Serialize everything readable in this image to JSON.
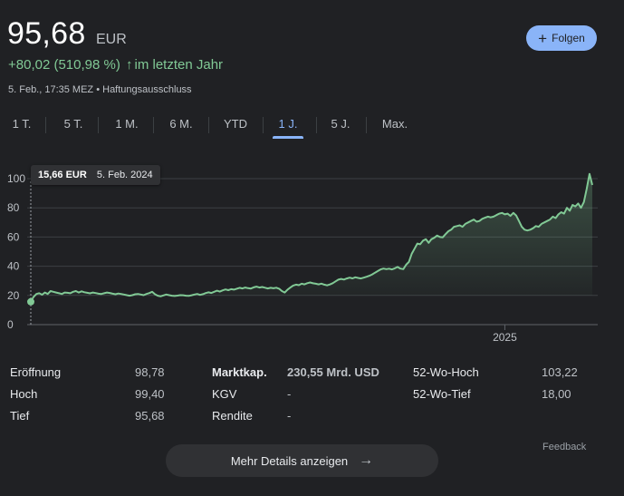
{
  "quote": {
    "price": "95,68",
    "currency": "EUR",
    "change_text": "+80,02 (510,98 %)",
    "change_arrow": "↑",
    "change_period": "im letzten Jahr",
    "meta": "5. Feb., 17:35 MEZ • Haftungsausschluss"
  },
  "follow_button": {
    "label": "Folgen",
    "icon": "plus-icon"
  },
  "tabs": [
    "1 T.",
    "5 T.",
    "1 M.",
    "6 M.",
    "YTD",
    "1 J.",
    "5 J.",
    "Max."
  ],
  "active_tab": "1 J.",
  "tooltip": {
    "price": "15,66 EUR",
    "date": "5. Feb. 2024"
  },
  "colors": {
    "accent": "#8ab4f8",
    "positive": "#81c995",
    "background": "#202124"
  },
  "chart_data": {
    "type": "area",
    "y_ticks": [
      0,
      20,
      40,
      60,
      80,
      100
    ],
    "ylim": [
      0,
      105
    ],
    "x_tick_labels": [
      {
        "label": "2025",
        "index": 168
      }
    ],
    "grid": true,
    "series": [
      {
        "values": [
          15.66,
          19,
          21,
          21.5,
          20.5,
          22,
          21,
          23,
          22.5,
          22,
          21.5,
          21,
          22,
          21.8,
          21.5,
          22.5,
          23,
          22,
          22.8,
          22.2,
          21.8,
          21.4,
          22,
          21.6,
          21.2,
          21,
          21.5,
          22,
          21.7,
          21.2,
          20.8,
          21.3,
          21,
          20.6,
          20.2,
          19.8,
          20.2,
          20.8,
          21,
          20.6,
          20.2,
          21,
          21.6,
          22.5,
          20.8,
          19.8,
          19.4,
          20,
          20.6,
          20.2,
          19.8,
          19.6,
          19.9,
          20.2,
          20.1,
          19.8,
          19.7,
          20.1,
          20.6,
          21,
          20.4,
          20.9,
          21.6,
          22.1,
          21.7,
          22.5,
          23.2,
          22.6,
          23.5,
          24.1,
          23.6,
          24.3,
          24,
          24.6,
          25.2,
          24.8,
          25.4,
          25,
          24.7,
          25.5,
          26,
          25.4,
          25.8,
          25.3,
          24.8,
          25.2,
          24.9,
          25.3,
          24.6,
          23,
          22,
          24,
          25.4,
          26.8,
          27.4,
          27,
          28,
          27.6,
          28.4,
          28.9,
          28.3,
          28,
          27.6,
          28.1,
          27.4,
          26.9,
          27.5,
          28.4,
          29.6,
          30.8,
          31.3,
          30.9,
          31.6,
          32.2,
          31.7,
          32.4,
          32,
          31.6,
          32.2,
          32.8,
          33.5,
          34.4,
          35.6,
          36.7,
          37.8,
          38.4,
          38,
          38.3,
          37.8,
          38.6,
          39.5,
          38.4,
          38,
          41,
          43,
          48.5,
          52,
          55.5,
          55,
          57.5,
          58.5,
          56,
          58.5,
          59.5,
          61,
          60,
          59.8,
          62,
          64,
          65,
          67,
          67.5,
          68,
          67,
          69,
          70,
          71,
          72,
          70.5,
          71,
          72.5,
          73.2,
          74,
          73.5,
          74,
          75,
          76,
          76.5,
          75.5,
          76,
          74.5,
          76.5,
          74.8,
          71,
          67,
          65,
          64.5,
          65,
          66,
          67.5,
          67,
          69,
          70,
          71,
          72,
          74,
          73,
          75.5,
          77,
          76,
          80,
          78,
          82,
          81,
          83,
          80,
          84,
          93,
          103.22,
          95.68
        ]
      }
    ]
  },
  "stats": {
    "col1": [
      {
        "label": "Eröffnung",
        "value": "98,78"
      },
      {
        "label": "Hoch",
        "value": "99,40"
      },
      {
        "label": "Tief",
        "value": "95,68"
      }
    ],
    "col2": [
      {
        "label": "Marktkap.",
        "value": "230,55 Mrd. USD"
      },
      {
        "label": "KGV",
        "value": "-"
      },
      {
        "label": "Rendite",
        "value": "-"
      }
    ],
    "col3": [
      {
        "label": "52-Wo-Hoch",
        "value": "103,22"
      },
      {
        "label": "52-Wo-Tief",
        "value": "18,00"
      }
    ]
  },
  "feedback_label": "Feedback",
  "details_button": {
    "label": "Mehr Details anzeigen",
    "icon": "arrow-right-icon"
  }
}
